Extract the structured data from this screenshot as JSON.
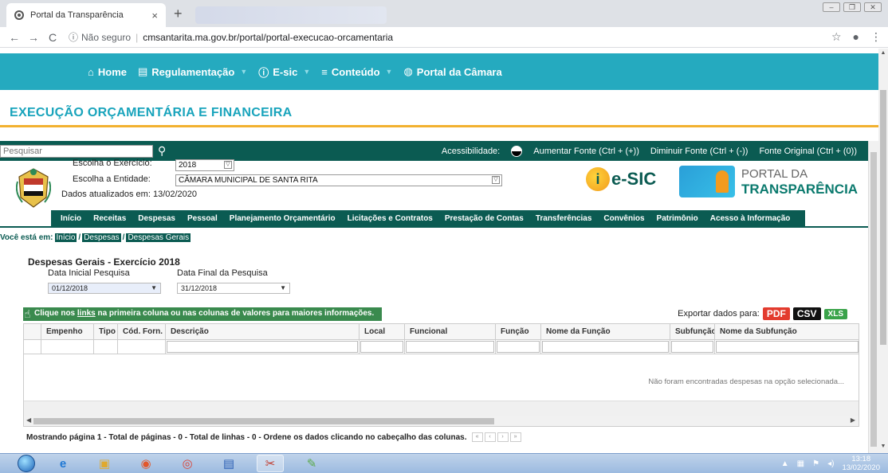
{
  "browser": {
    "tab_title": "Portal da Transparência",
    "tab_close": "×",
    "new_tab": "+",
    "security_label": "Não seguro",
    "url": "cmsantarita.ma.gov.br/portal/portal-execucao-orcamentaria"
  },
  "topnav": {
    "items": [
      {
        "label": "Home",
        "icon": "home-icon",
        "dropdown": false
      },
      {
        "label": "Regulamentação",
        "icon": "document-icon",
        "dropdown": true
      },
      {
        "label": "E-sic",
        "icon": "info-icon",
        "dropdown": true
      },
      {
        "label": "Conteúdo",
        "icon": "menu-icon",
        "dropdown": true
      },
      {
        "label": "Portal da Câmara",
        "icon": "globe-icon",
        "dropdown": false
      }
    ]
  },
  "page": {
    "title": "EXECUÇÃO ORÇAMENTÁRIA E FINANCEIRA"
  },
  "portal": {
    "search_placeholder": "Pesquisar",
    "accessibility": {
      "label": "Acessibilidade:",
      "increase": "Aumentar Fonte (Ctrl + (+))",
      "decrease": "Diminuir Fonte (Ctrl + (-))",
      "original": "Fonte Original (Ctrl + (0))"
    },
    "exercise_label": "Escolha o Exercício:",
    "exercise_value": "2018",
    "entity_label": "Escolha a Entidade:",
    "entity_value": "CÂMARA MUNICIPAL DE SANTA RITA",
    "updated": "Dados atualizados em: 13/02/2020",
    "esic_logo": "e-SIC",
    "portal_logo_line1": "PORTAL DA",
    "portal_logo_line2": "TRANSPARÊNCIA",
    "menu": [
      "Início",
      "Receitas",
      "Despesas",
      "Pessoal",
      "Planejamento Orçamentário",
      "Licitações e Contratos",
      "Prestação de Contas",
      "Transferências",
      "Convênios",
      "Patrimônio",
      "Acesso à Informação"
    ],
    "breadcrumb": {
      "prefix": "Você está em:",
      "items": [
        "Início",
        "Despesas",
        "Despesas Gerais"
      ]
    },
    "section_title": "Despesas Gerais - Exercício 2018",
    "date_start_label": "Data Inicial Pesquisa",
    "date_start_value": "01/12/2018",
    "date_end_label": "Data Final da Pesquisa",
    "date_end_value": "31/12/2018",
    "hint_pre": "Clique nos ",
    "hint_link": "links",
    "hint_post": " na primeira coluna ou nas colunas de valores para maiores informações.",
    "export_label": "Exportar dados para:",
    "export_pdf": "PDF",
    "export_csv": "CSV",
    "export_xls": "XLS",
    "columns": [
      "",
      "Empenho",
      "Tipo",
      "Cód. Forn.",
      "Descrição",
      "Local",
      "Funcional",
      "Função",
      "Nome da Função",
      "Subfunção",
      "Nome da Subfunção"
    ],
    "empty_message": "Não foram encontradas despesas na opção selecionada...",
    "pager_text": "Mostrando página 1 - Total de páginas - 0 - Total de linhas - 0 - Ordene os dados clicando no cabeçalho das colunas."
  },
  "taskbar": {
    "time": "13:18",
    "date": "13/02/2020"
  }
}
